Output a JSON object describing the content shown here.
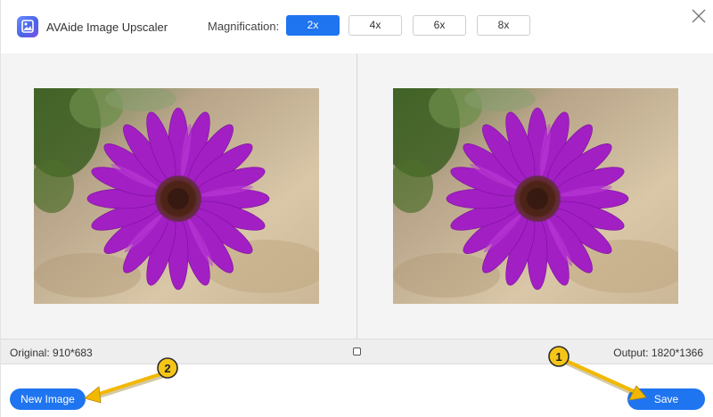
{
  "app": {
    "title": "AVAide Image Upscaler",
    "logo_icon": "image-gallery-icon"
  },
  "magnification": {
    "label": "Magnification:",
    "options": [
      "2x",
      "4x",
      "6x",
      "8x"
    ],
    "selected": "2x"
  },
  "status": {
    "original": "Original: 910*683",
    "output": "Output: 1820*1366"
  },
  "footer": {
    "new_image_label": "New Image",
    "save_label": "Save"
  },
  "annotations": {
    "badge_1": "1",
    "badge_2": "2"
  },
  "colors": {
    "accent": "#1f74f0",
    "badge": "#f5c518",
    "arrow": "#f2b800",
    "petal": "#a21fc4"
  }
}
